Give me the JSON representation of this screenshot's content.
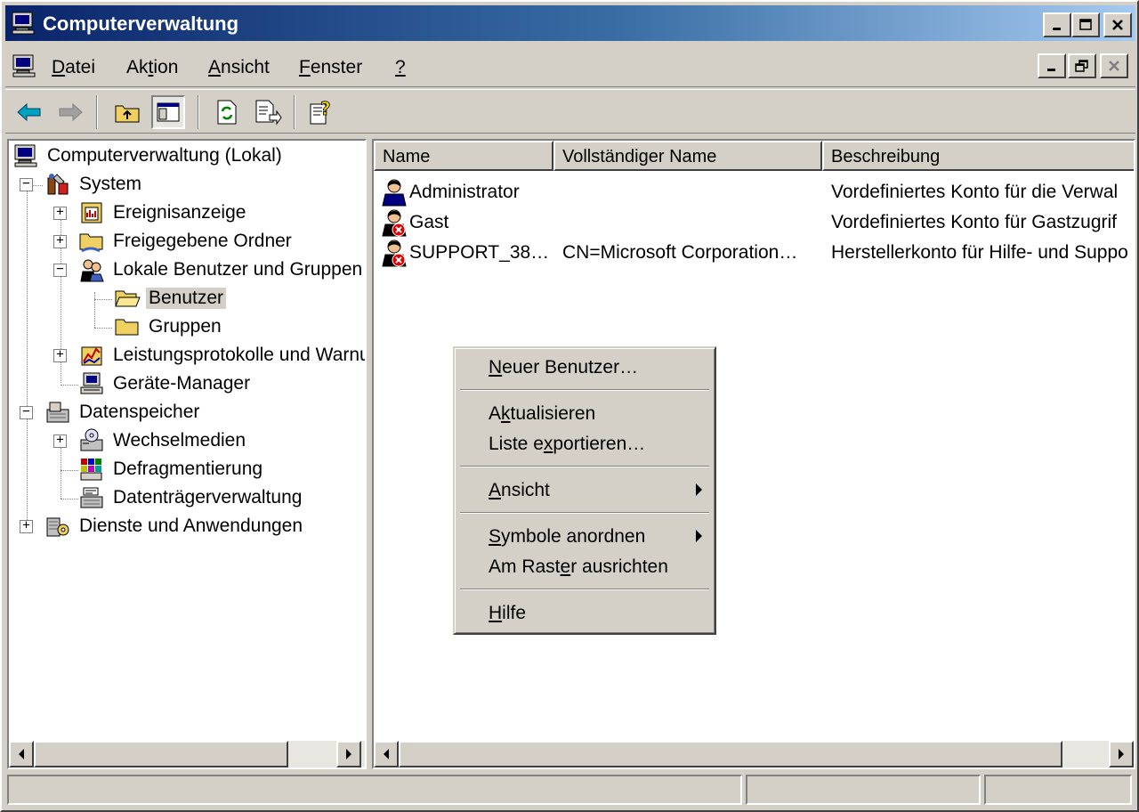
{
  "window": {
    "title": "Computerverwaltung"
  },
  "menubar": {
    "items": [
      {
        "pre": "",
        "key": "D",
        "post": "atei"
      },
      {
        "pre": "Ak",
        "key": "t",
        "post": "ion"
      },
      {
        "pre": "",
        "key": "A",
        "post": "nsicht"
      },
      {
        "pre": "",
        "key": "F",
        "post": "enster"
      },
      {
        "pre": "",
        "key": "?",
        "post": ""
      }
    ]
  },
  "tree": {
    "root": "Computerverwaltung (Lokal)",
    "system": "System",
    "ereignisanzeige": "Ereignisanzeige",
    "freigegebene_ordner": "Freigegebene Ordner",
    "lokale_benutzer": "Lokale Benutzer und Gruppen",
    "benutzer": "Benutzer",
    "gruppen": "Gruppen",
    "leistungsprotokolle": "Leistungsprotokolle und Warnungen",
    "geraete_manager": "Geräte-Manager",
    "datenspeicher": "Datenspeicher",
    "wechselmedien": "Wechselmedien",
    "defragmentierung": "Defragmentierung",
    "datentraegerverwaltung": "Datenträgerverwaltung",
    "dienste": "Dienste und Anwendungen"
  },
  "list": {
    "columns": [
      "Name",
      "Vollständiger Name",
      "Beschreibung"
    ],
    "rows": [
      {
        "name": "Administrator",
        "fullname": "",
        "description": "Vordefiniertes Konto für die Verwal",
        "disabled": false
      },
      {
        "name": "Gast",
        "fullname": "",
        "description": "Vordefiniertes Konto für Gastzugrif",
        "disabled": true
      },
      {
        "name": "SUPPORT_38…",
        "fullname": "CN=Microsoft Corporation…",
        "description": "Herstellerkonto für Hilfe- und Suppo",
        "disabled": true
      }
    ]
  },
  "context_menu": {
    "neuer_benutzer": {
      "pre": "",
      "key": "N",
      "post": "euer Benutzer…"
    },
    "aktualisieren": {
      "pre": "A",
      "key": "k",
      "post": "tualisieren"
    },
    "liste_exportieren": {
      "pre": "Liste e",
      "key": "x",
      "post": "portieren…"
    },
    "ansicht": {
      "pre": "",
      "key": "A",
      "post": "nsicht"
    },
    "symbole_anordnen": {
      "pre": "",
      "key": "S",
      "post": "ymbole anordnen"
    },
    "am_raster": {
      "pre": "Am Rast",
      "key": "e",
      "post": "r ausrichten"
    },
    "hilfe": {
      "pre": "",
      "key": "H",
      "post": "ilfe"
    }
  },
  "colors": {
    "titlebar_start": "#0a246a",
    "titlebar_end": "#a6caf0",
    "face": "#d4d0c8"
  }
}
